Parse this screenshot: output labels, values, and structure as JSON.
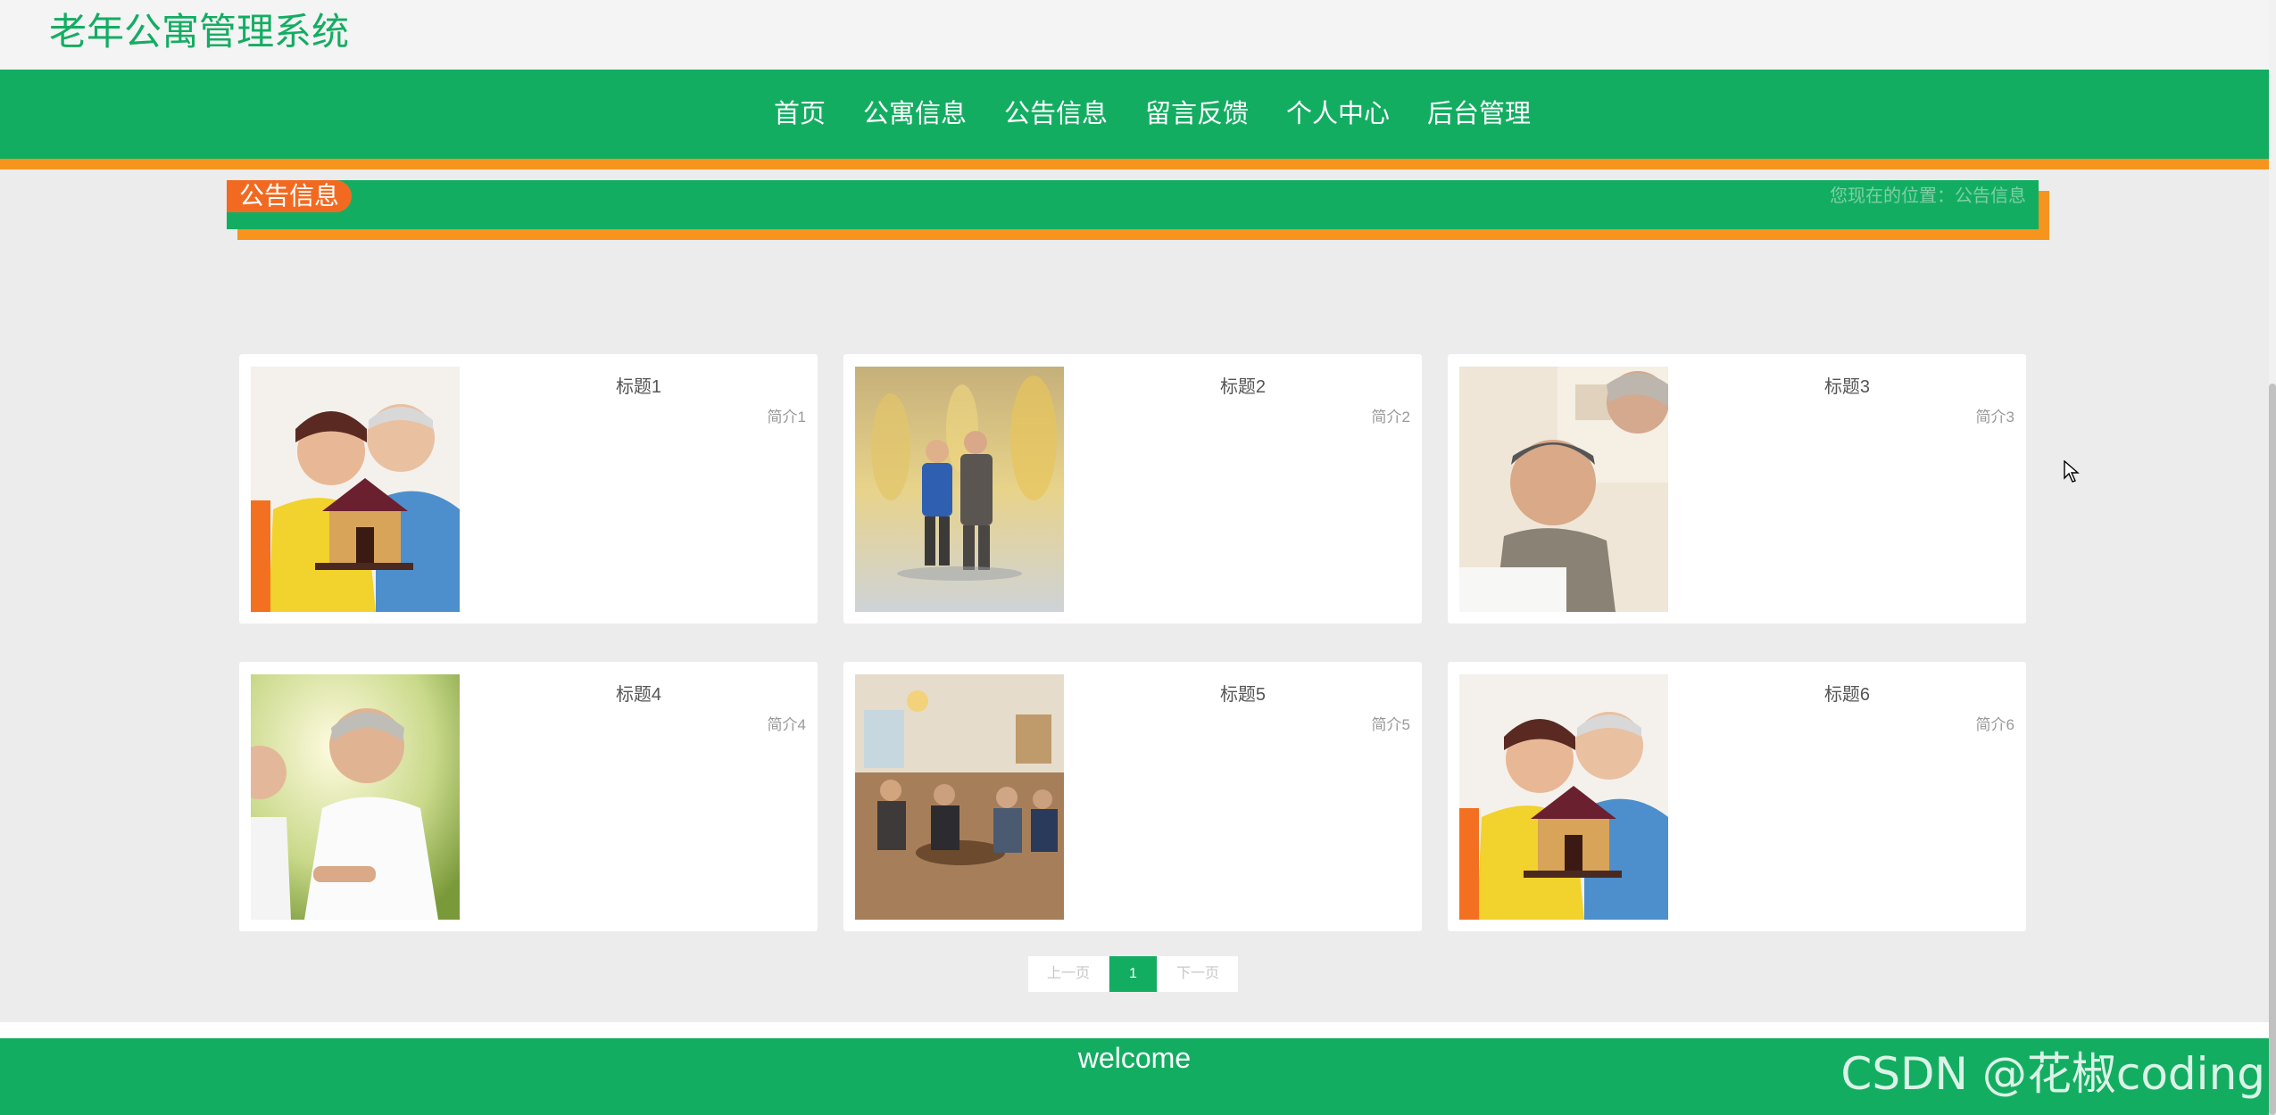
{
  "site": {
    "title": "老年公寓管理系统"
  },
  "nav": {
    "items": [
      "首页",
      "公寓信息",
      "公告信息",
      "留言反馈",
      "个人中心",
      "后台管理"
    ]
  },
  "section": {
    "tag": "公告信息",
    "breadcrumb_prefix": "您现在的位置：",
    "breadcrumb_current": "公告信息"
  },
  "cards": [
    {
      "title": "标题1",
      "desc": "简介1",
      "image": "seniors-holding-house-model"
    },
    {
      "title": "标题2",
      "desc": "简介2",
      "image": "elderly-couple-figurine"
    },
    {
      "title": "标题3",
      "desc": "简介3",
      "image": "smiling-elderly-man-reading"
    },
    {
      "title": "标题4",
      "desc": "简介4",
      "image": "elderly-man-white-shirt"
    },
    {
      "title": "标题5",
      "desc": "简介5",
      "image": "nursing-home-lounge"
    },
    {
      "title": "标题6",
      "desc": "简介6",
      "image": "seniors-holding-house-model"
    }
  ],
  "pagination": {
    "prev": "上一页",
    "current": "1",
    "next": "下一页"
  },
  "footer": {
    "text": "welcome",
    "watermark": "CSDN @花椒coding"
  },
  "colors": {
    "primary": "#13ad62",
    "accent": "#f7941d",
    "tag": "#f26a21"
  }
}
